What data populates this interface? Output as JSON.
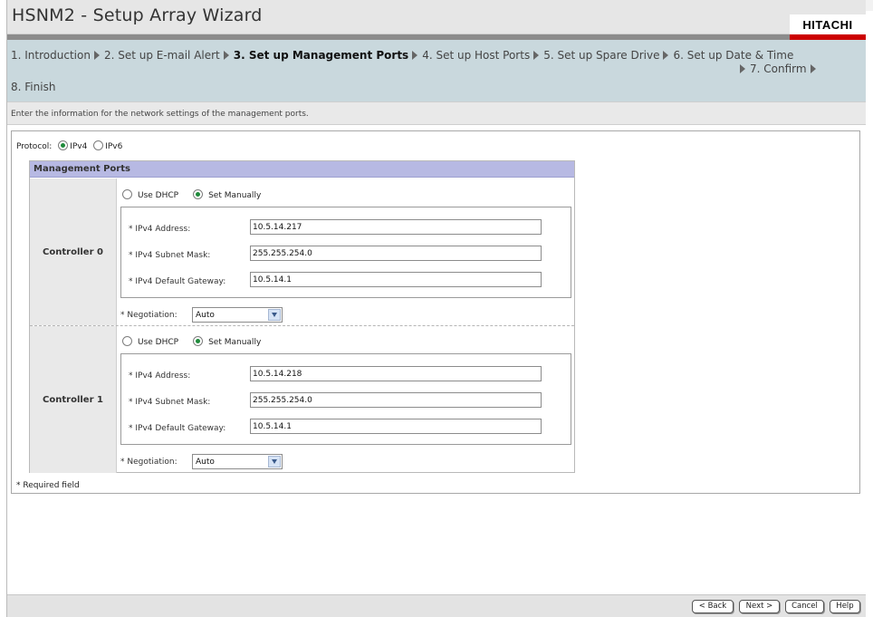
{
  "window": {
    "title": "HSNM2 - Setup Array Wizard",
    "brand": "HITACHI"
  },
  "steps": [
    {
      "label": "1. Introduction",
      "current": false
    },
    {
      "label": "2. Set up E-mail Alert",
      "current": false
    },
    {
      "label": "3. Set up Management Ports",
      "current": true
    },
    {
      "label": "4. Set up Host Ports",
      "current": false
    },
    {
      "label": "5. Set up Spare Drive",
      "current": false
    },
    {
      "label": "6. Set up Date & Time",
      "current": false
    },
    {
      "label": "7. Confirm",
      "current": false
    },
    {
      "label": "8. Finish",
      "current": false
    }
  ],
  "instruction": "Enter the information for the network settings of the management ports.",
  "protocol": {
    "label": "Protocol:",
    "options": [
      "IPv4",
      "IPv6"
    ],
    "selected": "IPv4"
  },
  "management_ports": {
    "header": "Management Ports",
    "mode_options": [
      "Use DHCP",
      "Set Manually"
    ],
    "field_labels": {
      "address": "* IPv4 Address:",
      "subnet": "* IPv4 Subnet Mask:",
      "gateway": "* IPv4 Default Gateway:",
      "negotiation": "* Negotiation:"
    },
    "controllers": [
      {
        "name": "Controller 0",
        "mode": "Set Manually",
        "address": "10.5.14.217",
        "subnet": "255.255.254.0",
        "gateway": "10.5.14.1",
        "negotiation": "Auto"
      },
      {
        "name": "Controller 1",
        "mode": "Set Manually",
        "address": "10.5.14.218",
        "subnet": "255.255.254.0",
        "gateway": "10.5.14.1",
        "negotiation": "Auto"
      }
    ]
  },
  "required_note": "* Required field",
  "buttons": {
    "back": "< Back",
    "next": "Next >",
    "cancel": "Cancel",
    "help": "Help"
  },
  "colors": {
    "brand_red": "#cc0000",
    "steps_bg": "#c9d8dd",
    "section_header": "#b7b9e3",
    "radio_dot": "#1f8a3b"
  }
}
